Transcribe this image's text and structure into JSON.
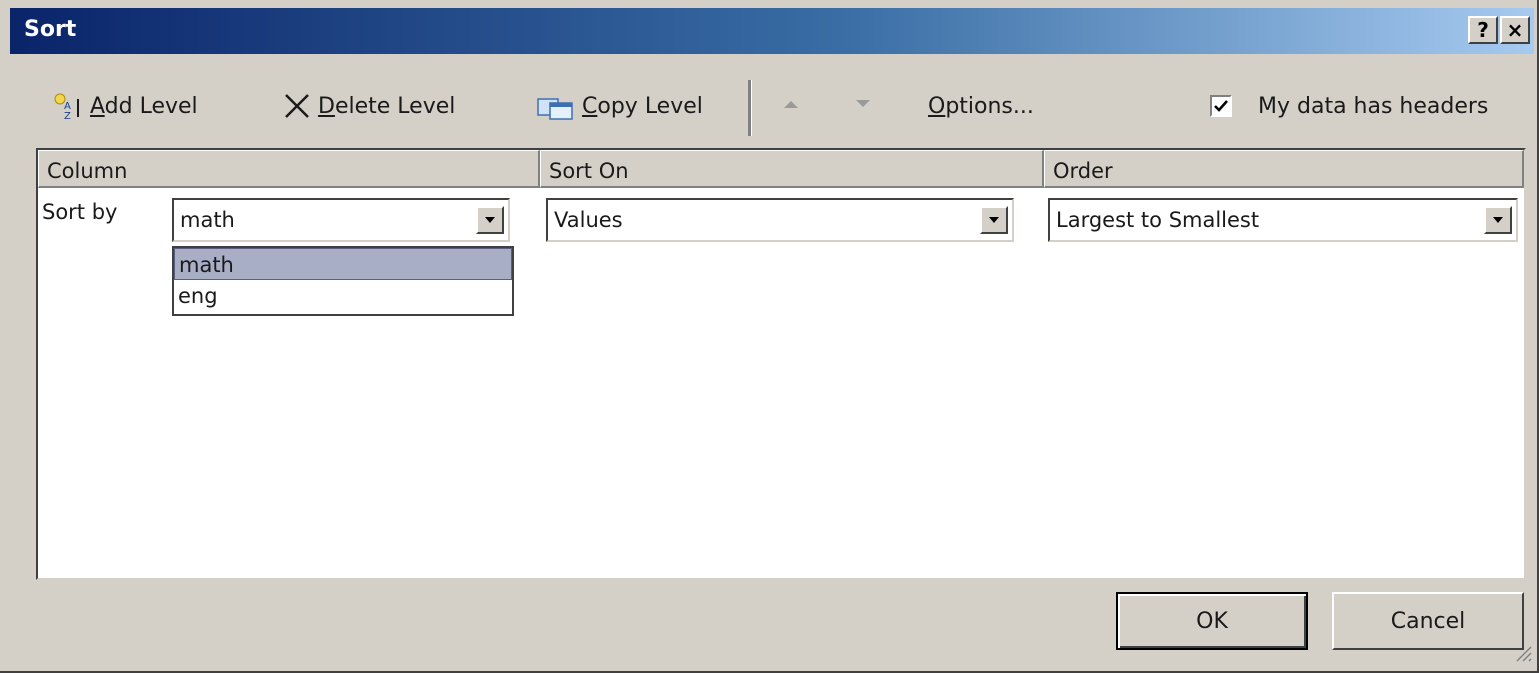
{
  "window": {
    "title": "Sort",
    "help_label": "?",
    "close_label": "×"
  },
  "toolbar": {
    "add_level": "Add Level",
    "delete_level": "Delete Level",
    "copy_level": "Copy Level",
    "options": "Options...",
    "headers_checkbox_label": "My data has headers",
    "headers_checked": true
  },
  "grid": {
    "headers": [
      "Column",
      "Sort On",
      "Order"
    ],
    "row_label": "Sort by",
    "column_value": "math",
    "sort_on_value": "Values",
    "order_value": "Largest to Smallest"
  },
  "dropdown": {
    "items": [
      "math",
      "eng"
    ],
    "selected": "math"
  },
  "buttons": {
    "ok": "OK",
    "cancel": "Cancel"
  },
  "icons": {
    "add_level": "add-level-icon",
    "delete_level": "x-icon",
    "copy_level": "copy-icon",
    "move_up": "triangle-up-icon",
    "move_down": "triangle-down-icon",
    "combo_arrow": "chevron-down-icon",
    "size_grip": "resize-grip-icon"
  },
  "colors": {
    "title_gradient_start": "#0a246a",
    "title_gradient_end": "#a6caf0",
    "dialog_face": "#d4d0c8",
    "selection": "#a9aec7"
  }
}
